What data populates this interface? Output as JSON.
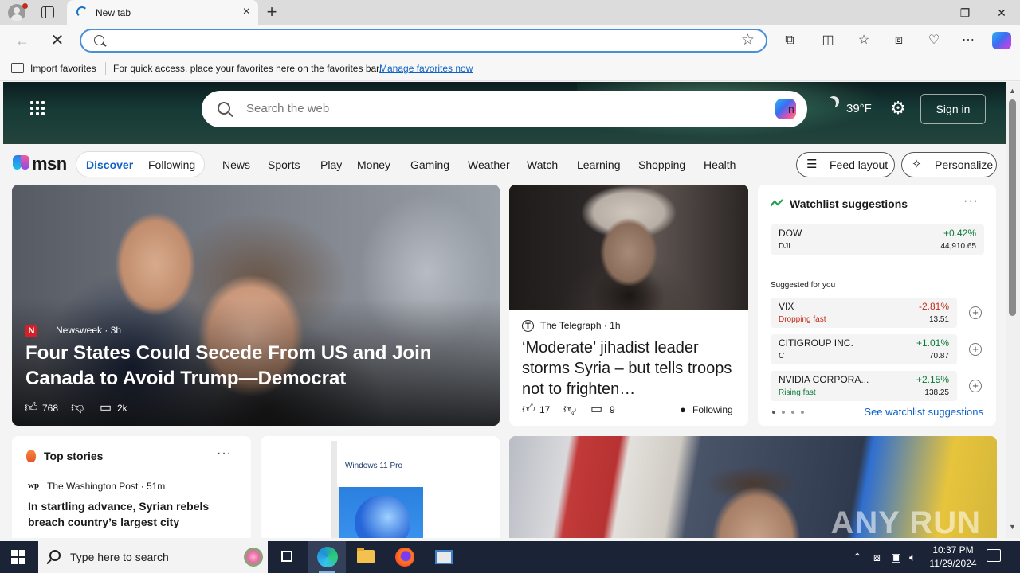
{
  "browser": {
    "tab_title": "New tab",
    "address_value": "",
    "favorites": {
      "import_label": "Import favorites",
      "hint": "For quick access, place your favorites here on the favorites bar.",
      "manage_link": "Manage favorites now"
    }
  },
  "msn": {
    "search_placeholder": "Search the web",
    "copilot_label": "n",
    "weather_temp": "39°F",
    "signin_label": "Sign in",
    "logo_text": "msn",
    "segments": [
      "Discover",
      "Following"
    ],
    "nav_items": [
      "News",
      "Sports",
      "Play",
      "Money",
      "Gaming",
      "Weather",
      "Watch",
      "Learning",
      "Shopping",
      "Health"
    ],
    "feed_layout_label": "Feed layout",
    "personalize_label": "Personalize"
  },
  "hero": {
    "source": "Newsweek",
    "time": "3h",
    "title": "Four States Could Secede From US and Join Canada to Avoid Trump—Democrat",
    "likes": "768",
    "comments": "2k"
  },
  "story2": {
    "source": "The Telegraph",
    "time": "1h",
    "title": "‘Moderate’ jihadist leader storms Syria – but tells troops not to frighten…",
    "likes": "17",
    "comments": "9",
    "following_label": "Following"
  },
  "watchlist": {
    "title": "Watchlist suggestions",
    "suggested_label": "Suggested for you",
    "see_more": "See watchlist suggestions",
    "up_color": "#0b7a3b",
    "down_color": "#c42b1c",
    "items": [
      {
        "name": "DOW",
        "sub": "DJI",
        "change": "+0.42%",
        "value": "44,910.65"
      },
      {
        "name": "VIX",
        "sub": "Dropping fast",
        "change": "-2.81%",
        "value": "13.51"
      },
      {
        "name": "CITIGROUP INC.",
        "sub": "C",
        "change": "+1.01%",
        "value": "70.87"
      },
      {
        "name": "NVIDIA CORPORA...",
        "sub": "Rising fast",
        "change": "+2.15%",
        "value": "138.25"
      }
    ]
  },
  "top_stories": {
    "title": "Top stories",
    "source": "The Washington Post",
    "time": "51m",
    "headline": "In startling advance, Syrian rebels breach country’s largest city"
  },
  "ad": {
    "box_label": "Windows 11 Pro"
  },
  "watermark": "ANY RUN",
  "taskbar": {
    "search_placeholder": "Type here to search",
    "time": "10:37 PM",
    "date": "11/29/2024"
  }
}
